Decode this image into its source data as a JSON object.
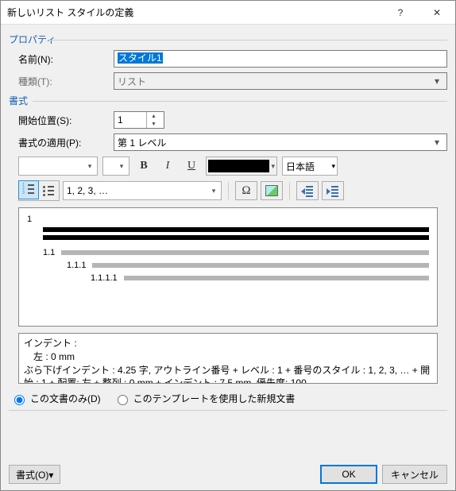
{
  "title": "新しいリスト スタイルの定義",
  "sections": {
    "properties": "プロパティ",
    "format": "書式"
  },
  "labels": {
    "name": "名前(N):",
    "type": "種類(T):",
    "start": "開始位置(S):",
    "apply": "書式の適用(P):"
  },
  "values": {
    "name": "スタイル1",
    "type": "リスト",
    "start": "1",
    "apply": "第 1 レベル",
    "numFormat": "1, 2, 3, …",
    "lang": "日本語"
  },
  "preview": {
    "l1": "1",
    "l2": "1.1",
    "l3": "1.1.1",
    "l4": "1.1.1.1"
  },
  "description": {
    "line1": "インデント :",
    "line2": "　左 :  0 mm",
    "line3": "ぶら下げインデント :  4.25 字, アウトライン番号 + レベル : 1 + 番号のスタイル : 1, 2, 3, … + 開始 : 1 + 配置: 左 + 整列 :  0 mm + インデント :  7.5 mm, 優先度: 100"
  },
  "radios": {
    "thisDoc": "この文書のみ(D)",
    "template": "このテンプレートを使用した新規文書"
  },
  "buttons": {
    "format": "書式(O)▾",
    "ok": "OK",
    "cancel": "キャンセル"
  }
}
